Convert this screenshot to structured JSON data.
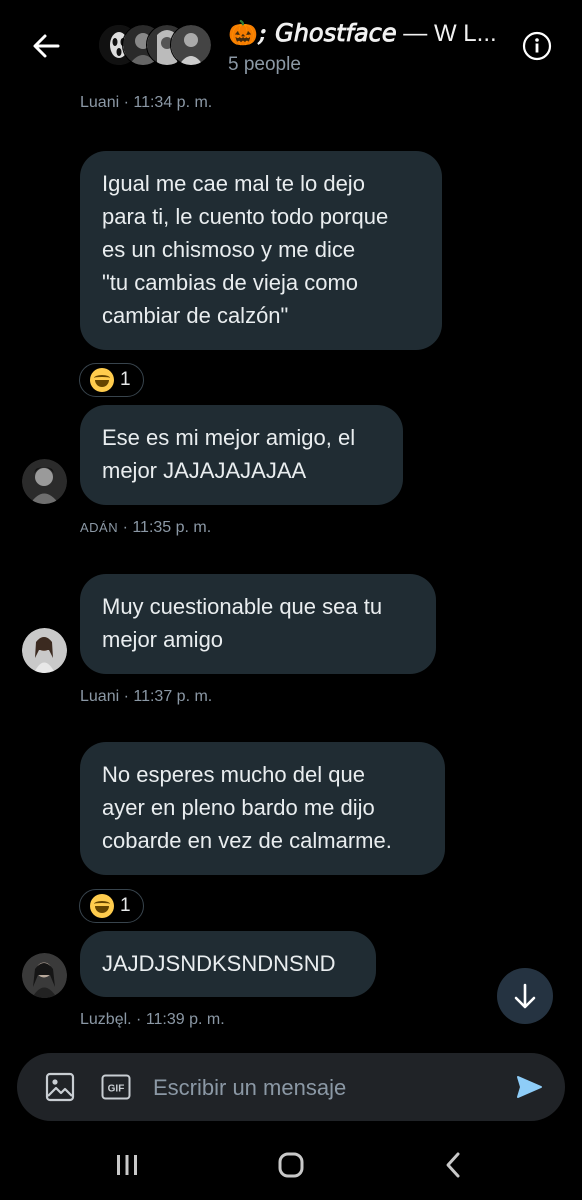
{
  "header": {
    "back_label": "←",
    "title_emoji": "🎃",
    "title_fancy": "; 𝘎𝘩𝘰𝘴𝘵𝘧𝘢𝘤𝘦",
    "title_rest": " — W L...",
    "subtitle": "5 people"
  },
  "messages": [
    {
      "kind": "meta",
      "text": "Luani · 11:34 p. m."
    },
    {
      "kind": "bubble",
      "lines": [
        "Igual me cae mal te lo dejo",
        "para ti, le cuento todo porque",
        "es un chismoso y me dice",
        "\"tu cambias de vieja como",
        "cambiar de calzón\""
      ]
    },
    {
      "kind": "reaction",
      "count": "1"
    },
    {
      "kind": "bubble",
      "lines": [
        "Ese es mi mejor amigo, el",
        "mejor JAJAJAJAJAA"
      ]
    },
    {
      "kind": "meta",
      "name": "ADÁN",
      "time": " · 11:35 p. m."
    },
    {
      "kind": "bubble",
      "lines": [
        "Muy cuestionable que sea tu",
        "mejor amigo"
      ]
    },
    {
      "kind": "meta",
      "text": "Luani · 11:37 p. m."
    },
    {
      "kind": "bubble",
      "lines": [
        "No esperes mucho del que",
        "ayer en pleno bardo me dijo",
        "cobarde en vez de calmarme."
      ]
    },
    {
      "kind": "reaction",
      "count": "1"
    },
    {
      "kind": "bubble",
      "lines": [
        "JAJDJSNDKSNDNSND"
      ]
    },
    {
      "kind": "meta",
      "text": "Luzbęl. · 11:39 p. m."
    }
  ],
  "composer": {
    "placeholder": "Escribir un mensaje",
    "gif_label": "GIF"
  },
  "colors": {
    "background": "#000000",
    "bubble": "#202c33",
    "meta_text": "#8b98a5",
    "accent": "#1d9bf0"
  }
}
